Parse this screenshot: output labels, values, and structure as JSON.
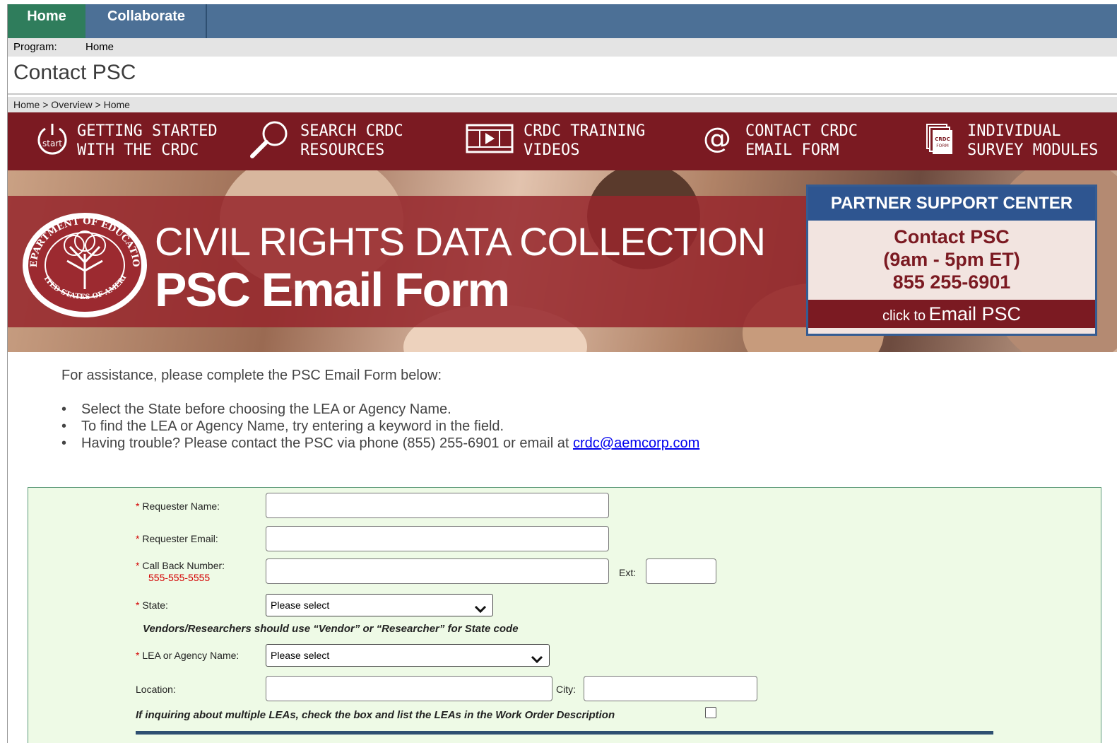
{
  "topnav": {
    "home": "Home",
    "collaborate": "Collaborate"
  },
  "program": {
    "label": "Program:",
    "value": "Home"
  },
  "page_title": "Contact PSC",
  "breadcrumb": "Home > Overview > Home",
  "icon_bar": {
    "items": [
      {
        "icon": "start-power-icon",
        "line1": "GETTING STARTED",
        "line2": "WITH THE CRDC",
        "icon_text": "start"
      },
      {
        "icon": "magnifier-icon",
        "line1": "SEARCH CRDC",
        "line2": "RESOURCES"
      },
      {
        "icon": "film-icon",
        "line1": "CRDC TRAINING",
        "line2": "VIDEOS"
      },
      {
        "icon": "at-icon",
        "line1": "CONTACT CRDC",
        "line2": "EMAIL FORM",
        "icon_text": "@"
      },
      {
        "icon": "forms-icon",
        "line1": "INDIVIDUAL",
        "line2": "SURVEY MODULES",
        "icon_text": "CRDC FORM"
      }
    ]
  },
  "banner": {
    "line1": "CIVIL RIGHTS DATA COLLECTION",
    "line2": "PSC Email Form",
    "seal_text_top": "DEPARTMENT OF EDUCATION",
    "seal_text_bottom": "UNITED STATES OF AMERICA"
  },
  "psc_box": {
    "header": "PARTNER SUPPORT CENTER",
    "line1": "Contact PSC",
    "line2": "(9am - 5pm ET)",
    "line3": "855 255-6901",
    "click_prefix": "click to",
    "click_main": "Email PSC"
  },
  "instructions": {
    "intro": "For assistance, please complete the PSC Email Form below:",
    "bullets": [
      "Select the State before choosing the LEA or Agency Name.",
      "To find the LEA or Agency Name, try entering a keyword in the field."
    ],
    "bullet3_prefix": "Having trouble? Please contact the PSC via phone (855) 255-6901 or email at ",
    "email": "crdc@aemcorp.com"
  },
  "form": {
    "required_mark": "*",
    "requester_name": {
      "label": "Requester Name:",
      "value": ""
    },
    "requester_email": {
      "label": "Requester Email:",
      "value": ""
    },
    "callback": {
      "label": "Call Back Number:",
      "format_hint": "555-555-5555",
      "value": "",
      "ext_label": "Ext:",
      "ext_value": ""
    },
    "state": {
      "label": "State:",
      "selected": "Please select"
    },
    "vendor_note": "Vendors/Researchers should use “Vendor” or “Researcher” for State code",
    "lea": {
      "label": "LEA or Agency Name:",
      "selected": "Please select"
    },
    "location": {
      "label": "Location:",
      "value": ""
    },
    "city": {
      "label": "City:",
      "value": ""
    },
    "multiple_lea_note": "If inquiring about multiple LEAs, check the box and list the LEAs in the Work Order Description",
    "multiple_lea_checked": false
  },
  "colors": {
    "nav_blue": "#4c7096",
    "home_green": "#2f7d5c",
    "crdc_maroon": "#7b1a22",
    "psc_blue": "#2e5590",
    "form_bg": "#eefae6",
    "required_red": "#d40000",
    "link_blue": "#0000ee"
  }
}
